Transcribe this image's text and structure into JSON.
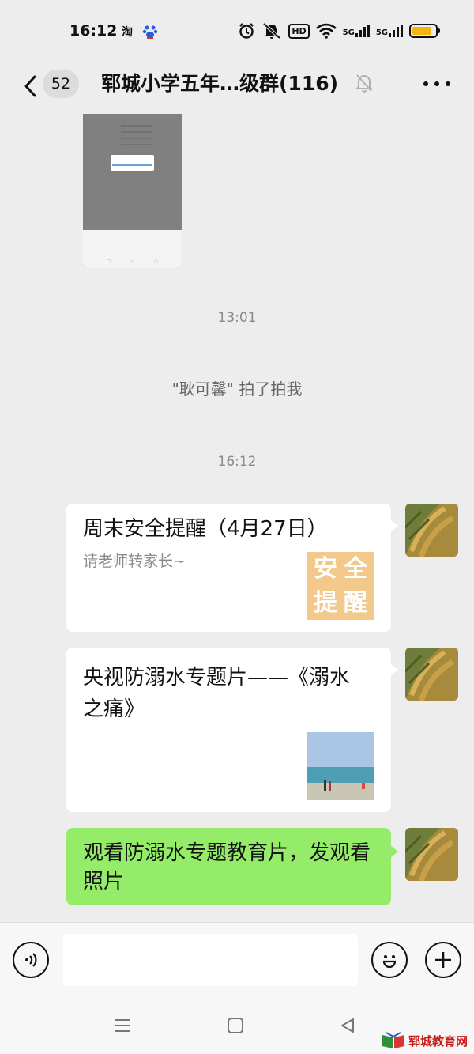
{
  "status_bar": {
    "time": "16:12",
    "app_icon_1": "淘",
    "hd": "HD",
    "signal_1": "5G",
    "signal_2": "5G",
    "battery_level": 0.85
  },
  "header": {
    "unread_count": "52",
    "title": "郓城小学五年…级群(116)"
  },
  "messages": {
    "timestamp_1": "13:01",
    "pat": "\"耿可馨\" 拍了拍我",
    "timestamp_2": "16:12",
    "link_1": {
      "title": "周末安全提醒（4月27日）",
      "desc": "请老师转家长~",
      "thumb_text": [
        "安",
        "全",
        "提",
        "醒"
      ]
    },
    "link_2": {
      "title_line1": "央视防溺水专题片——《溺水",
      "title_line2": "之痛》"
    },
    "text_1": "观看防溺水专题教育片，发观看照片"
  },
  "watermark": "郓城教育网",
  "colors": {
    "background": "#ededed",
    "bubble_green": "#95ec69",
    "battery": "#f5b40f",
    "watermark_red": "#c71c1c"
  }
}
